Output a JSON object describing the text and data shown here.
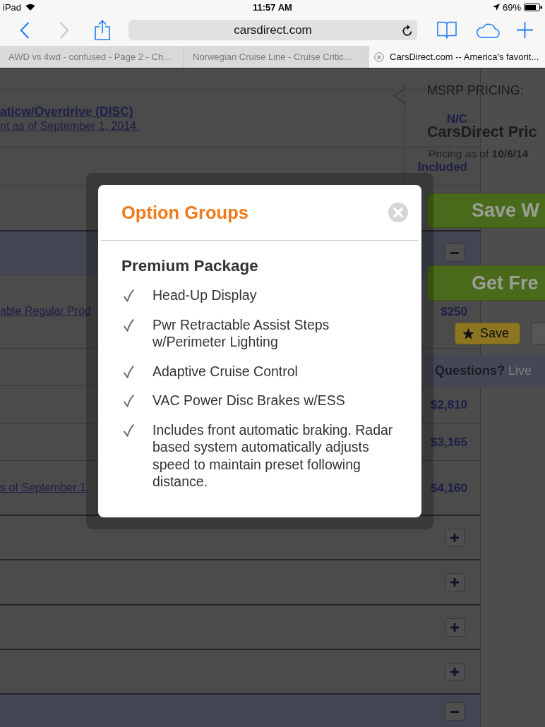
{
  "status_bar": {
    "device": "iPad",
    "time": "11:57 AM",
    "battery": "69%"
  },
  "toolbar": {
    "address": "carsdirect.com"
  },
  "tabs": [
    {
      "title": "AWD vs 4wd - confused - Page 2 - Ch...",
      "selected": false
    },
    {
      "title": "Norwegian Cruise Line - Cruise Critic...",
      "selected": false
    },
    {
      "title": "CarsDirect.com -- America's favorit...",
      "selected": true
    }
  ],
  "options_table": {
    "rows": [
      {
        "kind": "item",
        "name": "aticw/Overdrive (DISC)",
        "note": "nt as of September 1, 2014.",
        "price": "N/C"
      },
      {
        "kind": "item",
        "price": "Included"
      },
      {
        "kind": "item"
      },
      {
        "kind": "group",
        "expanded": true
      },
      {
        "kind": "item",
        "note": "able Regular Prod",
        "price": "$250"
      },
      {
        "kind": "item"
      },
      {
        "kind": "item",
        "price": "$2,810"
      },
      {
        "kind": "item",
        "price": "$3,165"
      },
      {
        "kind": "item",
        "note": "s of September 1,",
        "price": "$4,160"
      },
      {
        "kind": "group",
        "expanded": false
      },
      {
        "kind": "group",
        "expanded": false
      },
      {
        "kind": "group",
        "expanded": false
      },
      {
        "kind": "group",
        "expanded": false
      },
      {
        "kind": "group",
        "expanded": true
      }
    ]
  },
  "pricing_panel": {
    "heading": "MSRP PRICING:",
    "title": "CarsDirect Pric",
    "date_note": "Pricing as of **10/6/14**",
    "offer_buttons": [
      "Save W",
      "Get Fre"
    ],
    "save_button": "Save",
    "questions": {
      "label": "Questions?",
      "link": "Live"
    }
  },
  "dialog": {
    "title": "Option Groups",
    "package": "Premium Package",
    "features": [
      "Head-Up Display",
      "Pwr Retractable Assist Steps w/Perimeter Lighting",
      "Adaptive Cruise Control",
      "VAC Power Disc Brakes w/ESS",
      "Includes front automatic braking. Radar based system automatically adjusts speed to maintain preset following distance."
    ]
  }
}
